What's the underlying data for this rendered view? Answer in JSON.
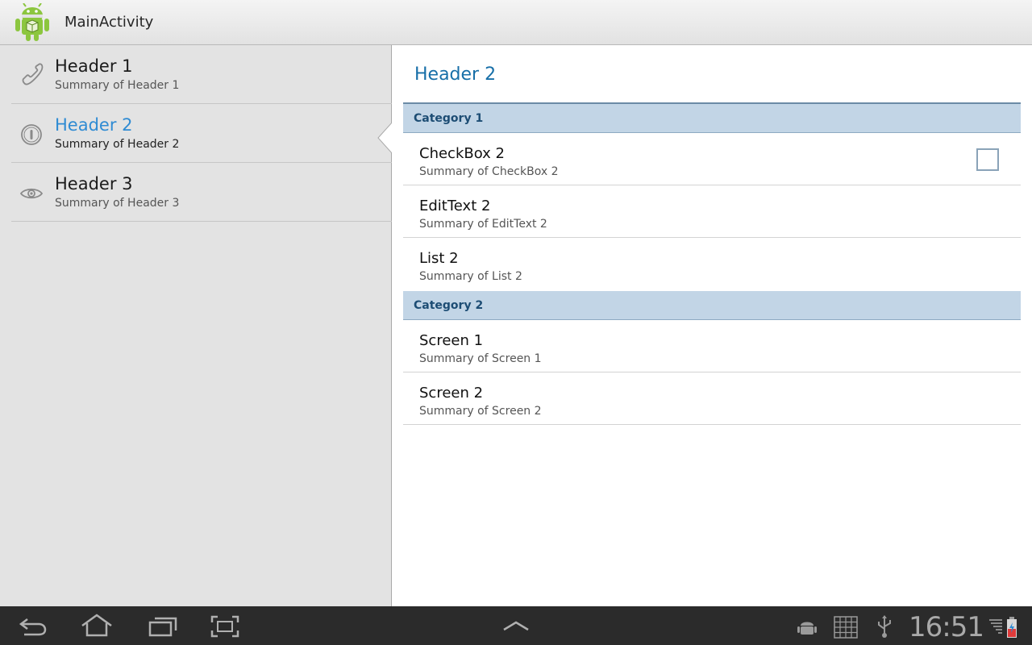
{
  "app": {
    "title": "MainActivity"
  },
  "headers": [
    {
      "title": "Header 1",
      "summary": "Summary of Header 1",
      "icon": "phone-icon"
    },
    {
      "title": "Header 2",
      "summary": "Summary of Header 2",
      "icon": "info-icon",
      "selected": true
    },
    {
      "title": "Header 3",
      "summary": "Summary of Header 3",
      "icon": "eye-icon"
    }
  ],
  "detail": {
    "title": "Header 2",
    "categories": [
      {
        "title": "Category 1",
        "items": [
          {
            "title": "CheckBox 2",
            "summary": "Summary of CheckBox 2",
            "checked": false
          },
          {
            "title": "EditText 2",
            "summary": "Summary of EditText 2"
          },
          {
            "title": "List 2",
            "summary": "Summary of List 2"
          }
        ]
      },
      {
        "title": "Category 2",
        "items": [
          {
            "title": "Screen 1",
            "summary": "Summary of Screen 1"
          },
          {
            "title": "Screen 2",
            "summary": "Summary of Screen 2"
          }
        ]
      }
    ]
  },
  "statusbar": {
    "time": "16:51",
    "nav_icons": [
      "back-icon",
      "home-icon",
      "recent-apps-icon",
      "screenshot-icon",
      "menu-up-icon"
    ],
    "status_icons": [
      "android-debug-icon",
      "keyboard-grid-icon",
      "usb-icon",
      "signal-icon",
      "battery-icon"
    ]
  },
  "colors": {
    "accent": "#2f8bd3",
    "category_bg": "#c2d5e6",
    "category_text": "#1d4d74"
  }
}
